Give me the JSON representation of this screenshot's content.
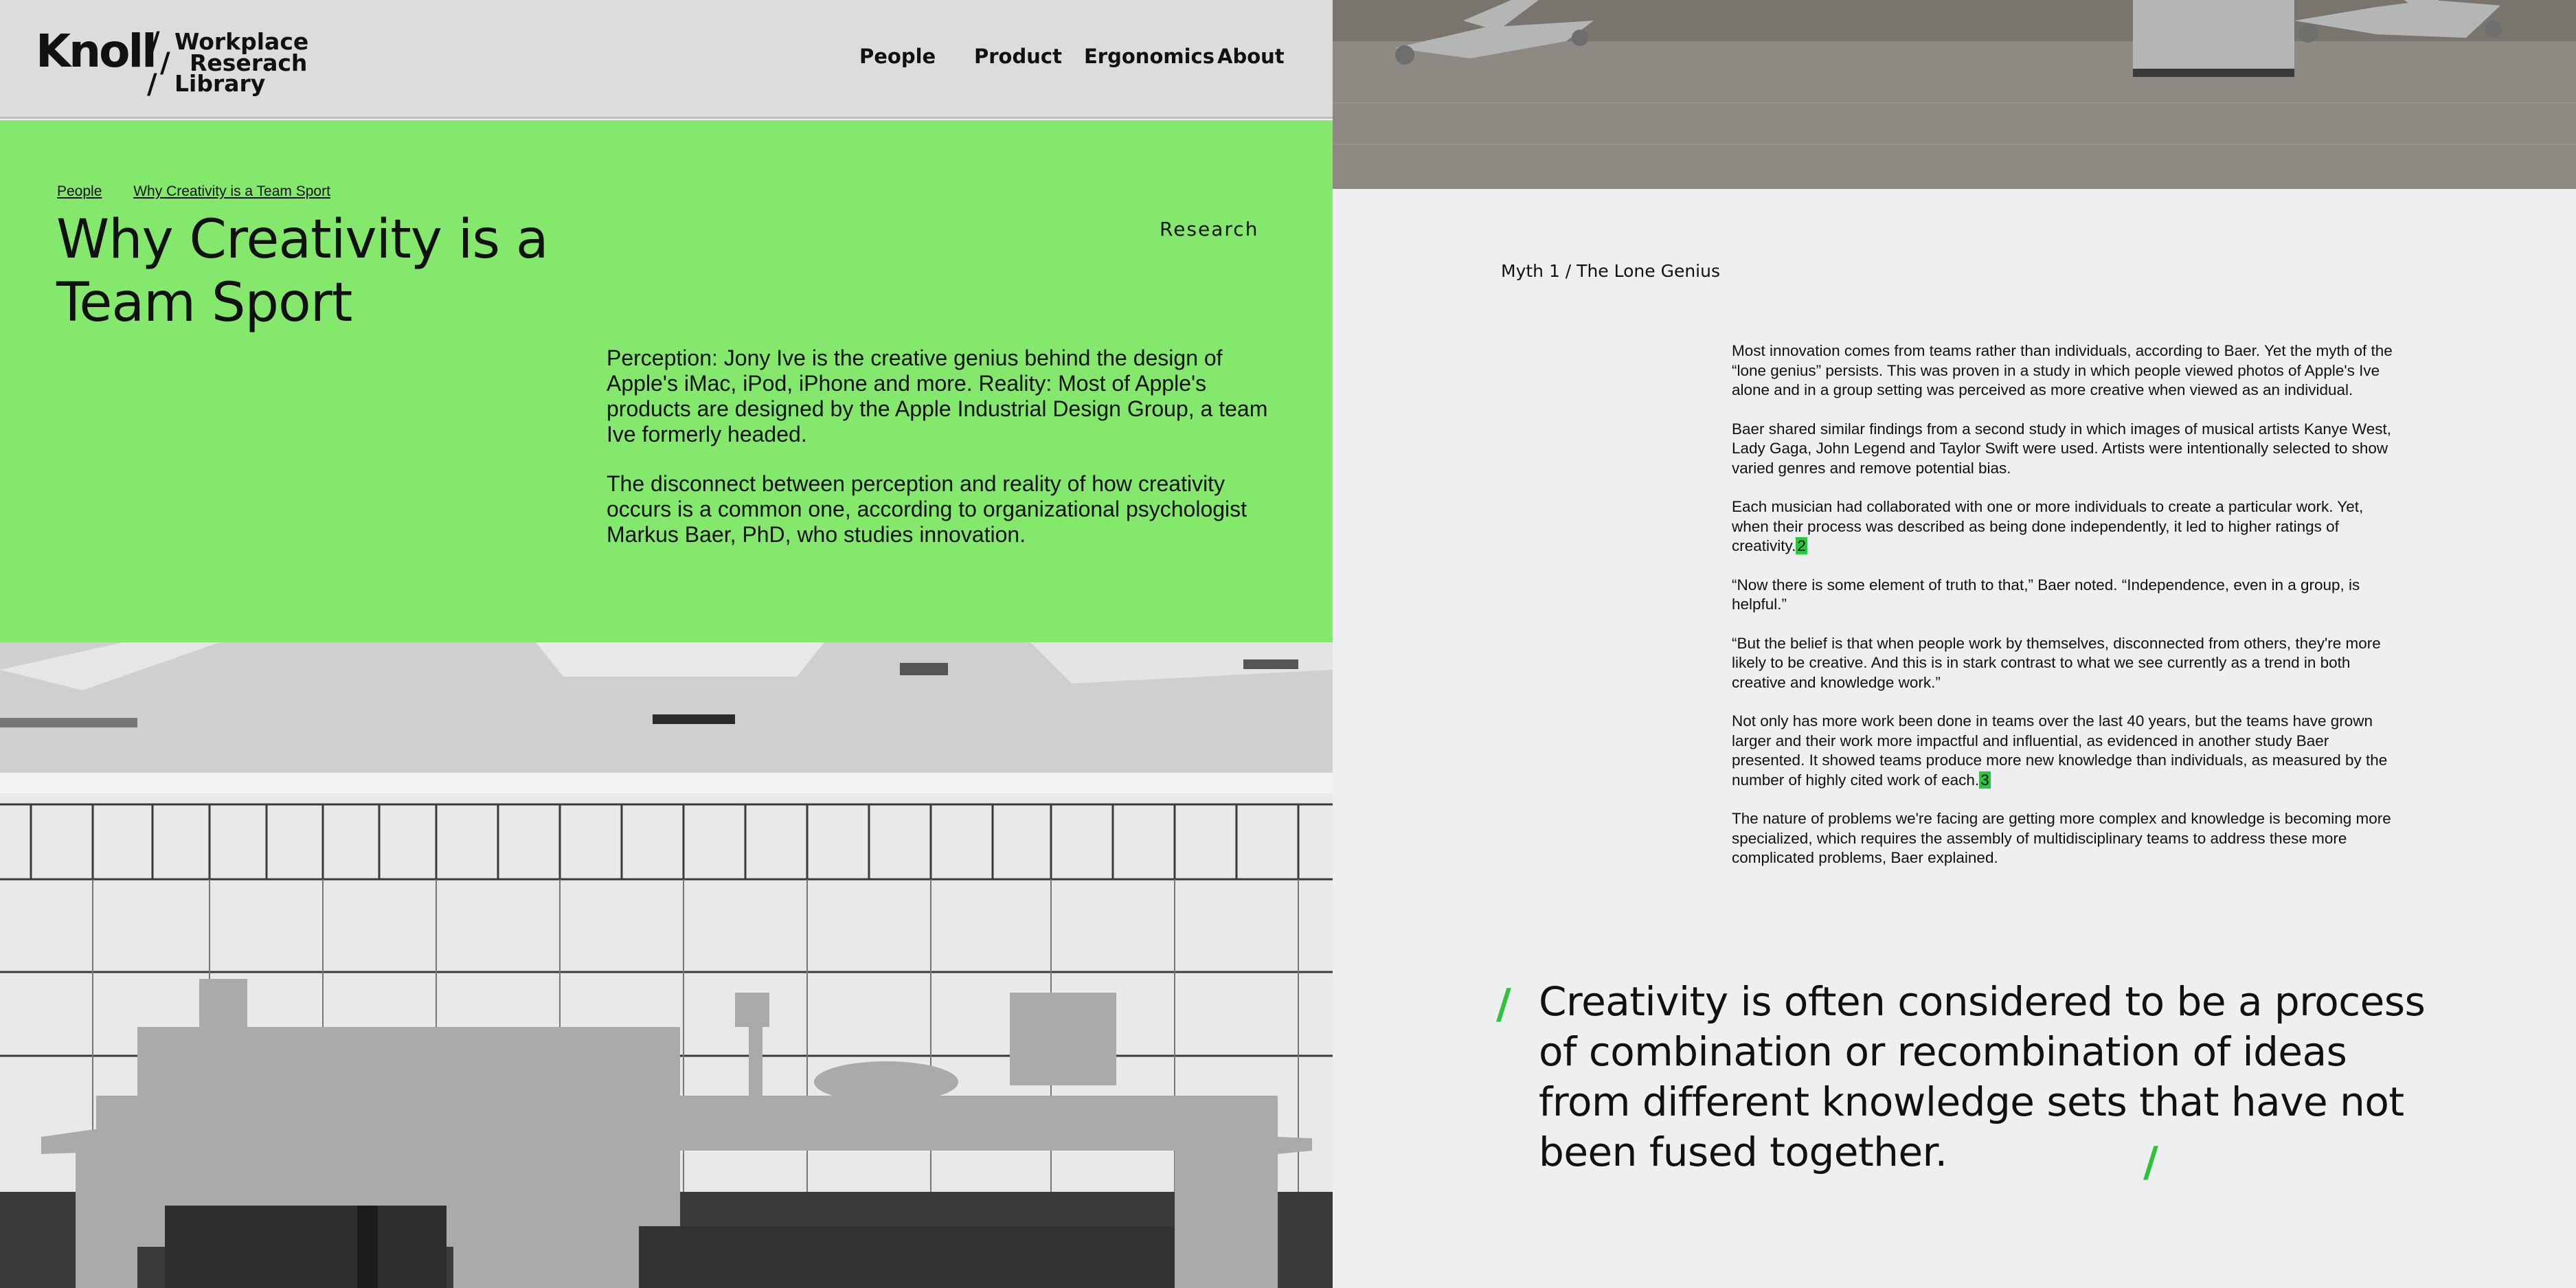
{
  "header": {
    "logo_text": "Knoll",
    "library_lines": [
      "Workplace",
      "Reserach",
      "Library"
    ],
    "slash": "/",
    "nav": [
      "People",
      "Product",
      "Ergonomics",
      "About"
    ]
  },
  "hero": {
    "breadcrumb": [
      "People",
      "Why Creativity is a Team Sport"
    ],
    "title": "Why Creativity is a Team Sport",
    "category": "Research",
    "intro": [
      "Perception: Jony Ive is the creative genius behind the design of Apple's iMac, iPod, iPhone and more. Reality: Most of Apple's products are designed by the Apple Industrial Design Group, a team Ive formerly headed.",
      "The disconnect between perception and reality of how creativity occurs is a common one, according to organizational psychologist Markus Baer, PhD, who studies innovation."
    ]
  },
  "article": {
    "myth_heading": "Myth 1  / The Lone Genius",
    "paragraphs": [
      "Most innovation comes from teams rather than individuals, according to Baer. Yet the myth of the “lone genius” persists. This was proven in a study in which people viewed photos of Apple's Ive alone and in a group setting was perceived as more creative when viewed as an individual.",
      "Baer shared similar findings from a second study in which images of musical artists Kanye West, Lady Gaga, John Legend and Taylor Swift were used. Artists were intentionally selected to show varied genres and remove potential bias.",
      "Each musician had collaborated with one or more individuals to create a particular work. Yet, when their process was described as being done independently, it led to higher ratings of creativity.",
      "“Now there is some element of truth to that,” Baer noted. “Independence, even in a group, is helpful.”",
      "“But the belief is that when people work by themselves, disconnected from others, they're more likely to be creative. And this is in stark contrast to what we see currently as a trend in both creative and knowledge work.”",
      "Not only has more work been done in teams over the last 40 years, but the teams have grown larger and their work more impactful and influential, as evidenced in another study Baer presented. It showed teams produce more new knowledge than individuals, as measured by the number of highly cited work of each.",
      "The nature of problems we're facing are getting more complex and knowledge is becoming more specialized, which requires the assembly of multidisciplinary teams to address these more complicated problems, Baer explained."
    ],
    "footnotes": [
      "2",
      "3"
    ],
    "pull_quote": "Creativity is often considered to be a process of combination or recombination of ideas from different knowledge sets that have not been fused together.",
    "quote_mark": "/"
  },
  "colors": {
    "hero_green": "#83e86c",
    "accent_green": "#2cc43c",
    "header_gray": "#dcdcdc",
    "page_bg": "#eeeff0"
  },
  "icons": [
    "knoll-logo",
    "office-photo",
    "chair-photo"
  ]
}
